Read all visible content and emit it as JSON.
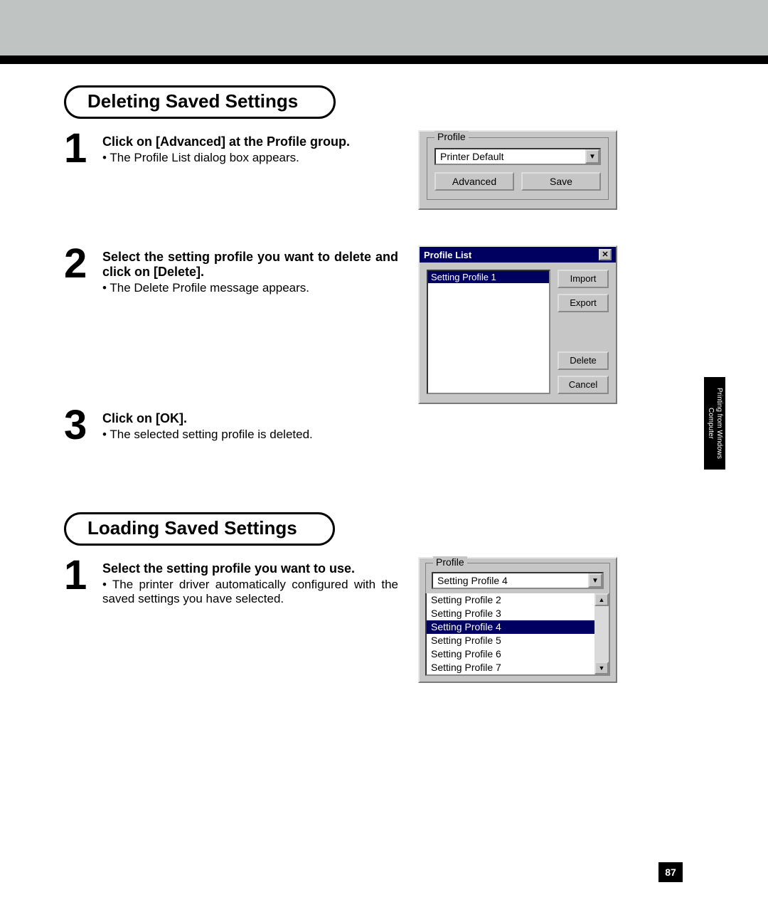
{
  "section1_title": "Deleting Saved Settings",
  "section2_title": "Loading Saved Settings",
  "steps_del": {
    "s1_num": "1",
    "s1_instr": "Click on [Advanced] at the Profile group.",
    "s1_bullet": "• The Profile List dialog box appears.",
    "s2_num": "2",
    "s2_instr": "Select the setting profile you want to delete and click on [Delete].",
    "s2_bullet": "• The Delete Profile message appears.",
    "s3_num": "3",
    "s3_instr": "Click on [OK].",
    "s3_bullet": "• The selected setting profile is deleted."
  },
  "steps_load": {
    "s1_num": "1",
    "s1_instr": "Select the setting profile you want to use.",
    "s1_bullet": "• The printer driver automatically configured with the saved settings you have selected."
  },
  "profile_group": {
    "legend": "Profile",
    "combo_value": "Printer Default",
    "advanced_btn": "Advanced",
    "save_btn": "Save"
  },
  "profile_list_dialog": {
    "title": "Profile List",
    "selected_item": "Setting Profile 1",
    "import_btn": "Import",
    "export_btn": "Export",
    "delete_btn": "Delete",
    "cancel_btn": "Cancel"
  },
  "profile_open": {
    "legend": "Profile",
    "combo_value": "Setting Profile 4",
    "items": [
      "Setting Profile 2",
      "Setting Profile 3",
      "Setting Profile 4",
      "Setting Profile 5",
      "Setting Profile 6",
      "Setting Profile 7"
    ],
    "selected_index": 2
  },
  "side_tab": "Printing from Windows Computer",
  "page_number": "87"
}
